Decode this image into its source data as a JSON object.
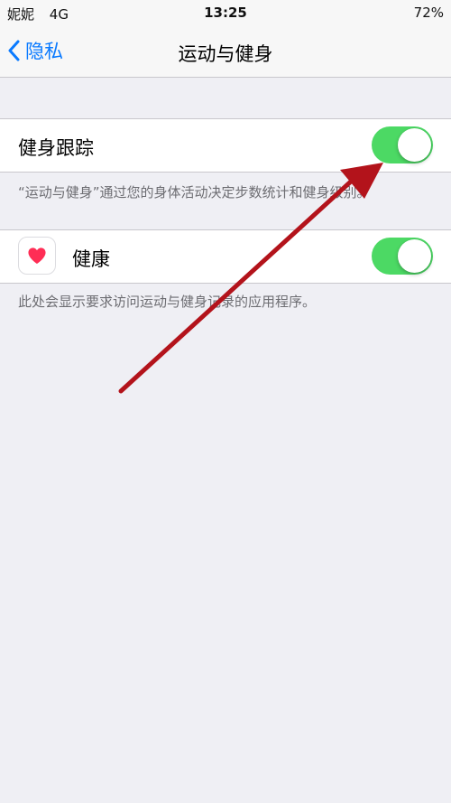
{
  "status_bar": {
    "carrier": "妮妮",
    "network": "4G",
    "time": "13:25",
    "battery": "72%"
  },
  "nav": {
    "back_label": "隐私",
    "title": "运动与健身"
  },
  "fitness_tracking": {
    "label": "健身跟踪",
    "enabled": true,
    "footnote": "“运动与健身”通过您的身体活动决定步数统计和健身级别。"
  },
  "apps": [
    {
      "label": "健康",
      "icon": "heart-icon",
      "enabled": true
    }
  ],
  "apps_footnote": "此处会显示要求访问运动与健身记录的应用程序。",
  "colors": {
    "accent": "#0a7aff",
    "toggle_on": "#4cd964",
    "background": "#efeff4",
    "annotation_arrow": "#b3131b",
    "heart": "#ff2d55"
  }
}
